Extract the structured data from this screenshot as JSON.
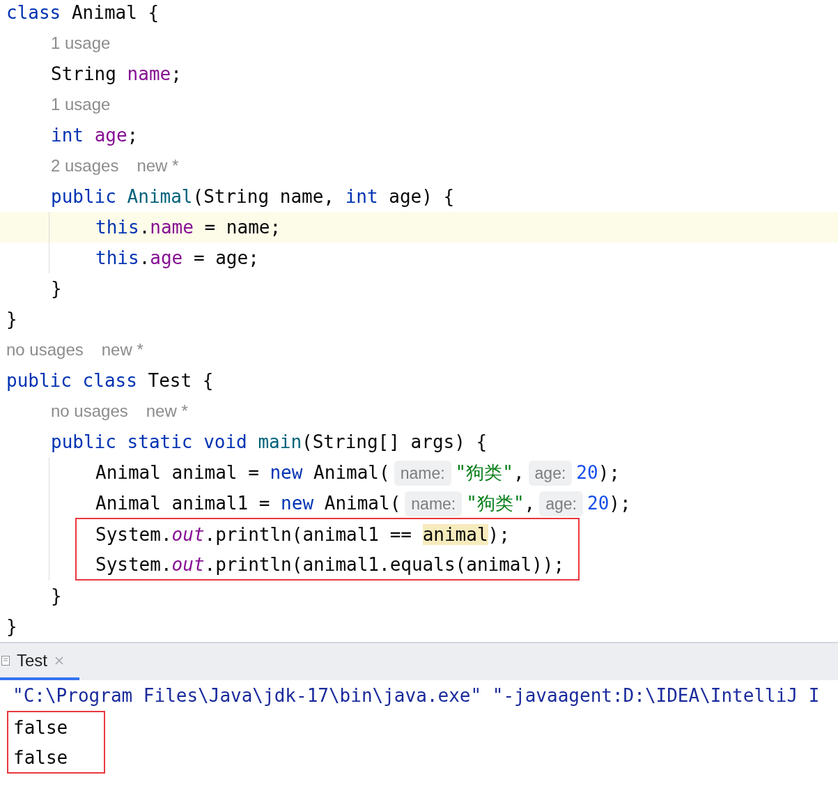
{
  "editor": {
    "lines": [
      {
        "kind": "code",
        "current": false,
        "tokens": [
          {
            "kind": "keyword",
            "text": "class"
          },
          {
            "kind": "plain",
            "text": " Animal {"
          }
        ],
        "children": [
          {
            "kind": "hint",
            "parts": [
              "1 usage"
            ]
          },
          {
            "kind": "code",
            "current": false,
            "tokens": [
              {
                "kind": "plain",
                "text": "String "
              },
              {
                "kind": "field",
                "text": "name"
              },
              {
                "kind": "plain",
                "text": ";"
              }
            ]
          },
          {
            "kind": "hint",
            "parts": [
              "1 usage"
            ]
          },
          {
            "kind": "code",
            "current": false,
            "tokens": [
              {
                "kind": "keyword",
                "text": "int "
              },
              {
                "kind": "field",
                "text": "age"
              },
              {
                "kind": "plain",
                "text": ";"
              }
            ]
          },
          {
            "kind": "hint",
            "parts": [
              "2 usages",
              "new *"
            ]
          },
          {
            "kind": "code",
            "current": false,
            "tokens": [
              {
                "kind": "keyword",
                "text": "public "
              },
              {
                "kind": "declaration",
                "text": "Animal"
              },
              {
                "kind": "plain",
                "text": "(String name, "
              },
              {
                "kind": "keyword",
                "text": "int"
              },
              {
                "kind": "plain",
                "text": " age) {"
              }
            ],
            "children": [
              {
                "kind": "code",
                "current": true,
                "tokens": [
                  {
                    "kind": "keyword",
                    "text": "this"
                  },
                  {
                    "kind": "plain",
                    "text": "."
                  },
                  {
                    "kind": "field",
                    "text": "name"
                  },
                  {
                    "kind": "plain",
                    "text": " = name;"
                  }
                ]
              },
              {
                "kind": "code",
                "current": false,
                "tokens": [
                  {
                    "kind": "keyword",
                    "text": "this"
                  },
                  {
                    "kind": "plain",
                    "text": "."
                  },
                  {
                    "kind": "field",
                    "text": "age"
                  },
                  {
                    "kind": "plain",
                    "text": " = age;"
                  }
                ]
              }
            ]
          },
          {
            "kind": "code",
            "current": false,
            "tokens": [
              {
                "kind": "plain",
                "text": "}"
              }
            ]
          }
        ]
      },
      {
        "kind": "code",
        "current": false,
        "tokens": [
          {
            "kind": "plain",
            "text": "}"
          }
        ]
      },
      {
        "kind": "hint",
        "parts": [
          "no usages",
          "new *"
        ]
      },
      {
        "kind": "code",
        "current": false,
        "tokens": [
          {
            "kind": "keyword",
            "text": "public class"
          },
          {
            "kind": "plain",
            "text": " Test {"
          }
        ],
        "children": [
          {
            "kind": "hint",
            "parts": [
              "no usages",
              "new *"
            ]
          },
          {
            "kind": "code",
            "current": false,
            "tokens": [
              {
                "kind": "keyword",
                "text": "public static void "
              },
              {
                "kind": "declaration",
                "text": "main"
              },
              {
                "kind": "plain",
                "text": "(String[] args) {"
              }
            ],
            "children": [
              {
                "kind": "code",
                "current": false,
                "tokens": [
                  {
                    "kind": "plain",
                    "text": "Animal animal = "
                  },
                  {
                    "kind": "keyword",
                    "text": "new"
                  },
                  {
                    "kind": "plain",
                    "text": " Animal("
                  },
                  {
                    "kind": "param",
                    "text": "name:"
                  },
                  {
                    "kind": "string",
                    "text": "\"狗类\""
                  },
                  {
                    "kind": "plain",
                    "text": ","
                  },
                  {
                    "kind": "param",
                    "text": "age:"
                  },
                  {
                    "kind": "number",
                    "text": "20"
                  },
                  {
                    "kind": "plain",
                    "text": ");"
                  }
                ]
              },
              {
                "kind": "code",
                "current": false,
                "tokens": [
                  {
                    "kind": "plain",
                    "text": "Animal animal1 = "
                  },
                  {
                    "kind": "keyword",
                    "text": "new"
                  },
                  {
                    "kind": "plain",
                    "text": " Animal("
                  },
                  {
                    "kind": "param",
                    "text": "name:"
                  },
                  {
                    "kind": "string",
                    "text": "\"狗类\""
                  },
                  {
                    "kind": "plain",
                    "text": ","
                  },
                  {
                    "kind": "param",
                    "text": "age:"
                  },
                  {
                    "kind": "number",
                    "text": "20"
                  },
                  {
                    "kind": "plain",
                    "text": ");"
                  }
                ]
              },
              {
                "kind": "group",
                "children": [
                  {
                    "kind": "code",
                    "current": false,
                    "tokens": [
                      {
                        "kind": "plain",
                        "text": "System."
                      },
                      {
                        "kind": "static",
                        "text": "out"
                      },
                      {
                        "kind": "plain",
                        "text": ".println(animal1 == "
                      },
                      {
                        "kind": "usage",
                        "text": "animal"
                      },
                      {
                        "kind": "plain",
                        "text": ");"
                      }
                    ]
                  },
                  {
                    "kind": "code",
                    "current": false,
                    "tokens": [
                      {
                        "kind": "plain",
                        "text": "System."
                      },
                      {
                        "kind": "static",
                        "text": "out"
                      },
                      {
                        "kind": "plain",
                        "text": ".println(animal1.equals(animal));"
                      }
                    ]
                  }
                ]
              }
            ]
          },
          {
            "kind": "code",
            "current": false,
            "tokens": [
              {
                "kind": "plain",
                "text": "}"
              }
            ]
          }
        ]
      },
      {
        "kind": "code",
        "current": false,
        "tokens": [
          {
            "kind": "plain",
            "text": "}"
          }
        ]
      }
    ]
  },
  "console": {
    "tabs": [
      {
        "label": "Test",
        "selected": true
      }
    ],
    "lines": [
      {
        "kind": "command",
        "text": "\"C:\\Program Files\\Java\\jdk-17\\bin\\java.exe\" \"-javaagent:D:\\IDEA\\IntelliJ I"
      },
      {
        "kind": "group",
        "children": [
          {
            "kind": "output",
            "text": "false"
          },
          {
            "kind": "output",
            "text": "false"
          }
        ]
      }
    ]
  }
}
